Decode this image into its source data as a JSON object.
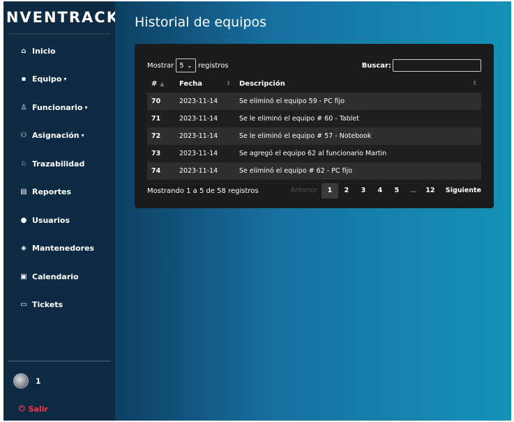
{
  "brand": "INVENTRACK",
  "sidebar": {
    "items": [
      {
        "label": "Inicio",
        "icon": "⌂"
      },
      {
        "label": "Equipo",
        "icon": "▪",
        "caret": "▾"
      },
      {
        "label": "Funcionario",
        "icon": "♙",
        "caret": "▾"
      },
      {
        "label": "Asignación",
        "icon": "⚇",
        "caret": "▾"
      },
      {
        "label": "Trazabilidad",
        "icon": "♘"
      },
      {
        "label": "Reportes",
        "icon": "▤"
      },
      {
        "label": "Usuarios",
        "icon": "●"
      },
      {
        "label": "Mantenedores",
        "icon": "◈"
      },
      {
        "label": "Calendario",
        "icon": "▣"
      },
      {
        "label": "Tickets",
        "icon": "▭"
      }
    ],
    "user_name": "1",
    "logout_label": "Salir",
    "logout_icon": "⏻"
  },
  "page": {
    "title": "Historial de equipos"
  },
  "table": {
    "show_label": "Mostrar",
    "show_value": "5",
    "records_label": "registros",
    "search_label": "Buscar:",
    "search_value": "",
    "columns": [
      "#",
      "Fecha",
      "Descripción"
    ],
    "rows": [
      {
        "id": "70",
        "date": "2023-11-14",
        "desc": "Se eliminó el equipo 59 - PC fijo"
      },
      {
        "id": "71",
        "date": "2023-11-14",
        "desc": "Se le eliminó el equipo # 60 - Tablet"
      },
      {
        "id": "72",
        "date": "2023-11-14",
        "desc": "Se le eliminó el equipo # 57 - Notebook"
      },
      {
        "id": "73",
        "date": "2023-11-14",
        "desc": "Se agregó el equipo 62 al funcionario Martin"
      },
      {
        "id": "74",
        "date": "2023-11-14",
        "desc": "Se eliminó el equipo # 62 - PC fijo"
      }
    ],
    "info": "Mostrando 1 a 5 de 58 registros",
    "pagination": {
      "previous": "Anterior",
      "pages": [
        "1",
        "2",
        "3",
        "4",
        "5",
        "…",
        "12"
      ],
      "next": "Siguiente"
    }
  }
}
